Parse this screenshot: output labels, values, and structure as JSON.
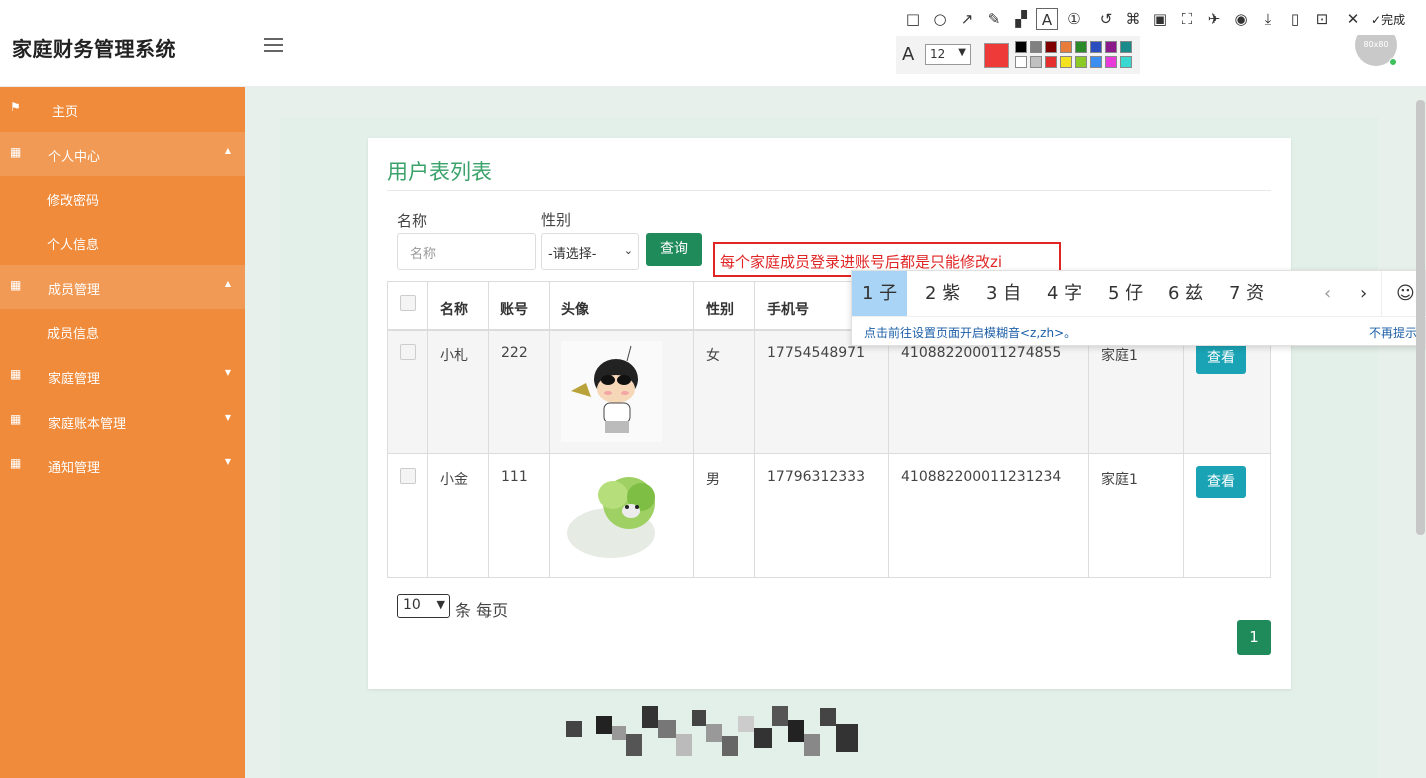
{
  "app": {
    "title": "家庭财务管理系统",
    "avatar_text": "80x80"
  },
  "sidebar": {
    "items": [
      {
        "label": "主页",
        "icon": "flag-icon"
      },
      {
        "label": "个人中心",
        "icon": "grid-icon"
      },
      {
        "label": "修改密码"
      },
      {
        "label": "个人信息"
      },
      {
        "label": "成员管理",
        "icon": "grid-icon"
      },
      {
        "label": "成员信息"
      },
      {
        "label": "家庭管理",
        "icon": "grid-icon"
      },
      {
        "label": "家庭账本管理",
        "icon": "grid-icon"
      },
      {
        "label": "通知管理",
        "icon": "grid-icon"
      }
    ]
  },
  "page": {
    "title": "用户表列表"
  },
  "filters": {
    "name_label": "名称",
    "name_placeholder": "名称",
    "gender_label": "性别",
    "gender_value": "-请选择-",
    "search_label": "查询"
  },
  "table": {
    "headers": [
      "名称",
      "账号",
      "头像",
      "性别",
      "手机号"
    ],
    "rows": [
      {
        "name": "小札",
        "account": "222",
        "gender": "女",
        "phone": "17754548971",
        "id_no": "410882200011274855",
        "family": "家庭1",
        "action": "查看"
      },
      {
        "name": "小金",
        "account": "111",
        "gender": "男",
        "phone": "17796312333",
        "id_no": "410882200011231234",
        "family": "家庭1",
        "action": "查看"
      }
    ]
  },
  "pager": {
    "page_size": "10",
    "suffix": "条 每页",
    "current": "1"
  },
  "annotation": {
    "text": "每个家庭成员登录进账号后都是只能修改zi"
  },
  "ime": {
    "candidates": [
      "1 子",
      "2 紫",
      "3 自",
      "4 字",
      "5 仔",
      "6 兹",
      "7 资"
    ],
    "hint": "点击前往设置页面开启模糊音<z,zh>。",
    "dismiss": "不再提示"
  },
  "toolbar": {
    "done_label": "完成",
    "font_size": "12",
    "font_icon_label": "A"
  },
  "colors": {
    "sidebar": "#ef8b3b",
    "accent": "#1f8a5a",
    "view_button": "#1aa3b4",
    "annotation": "#e12525"
  }
}
